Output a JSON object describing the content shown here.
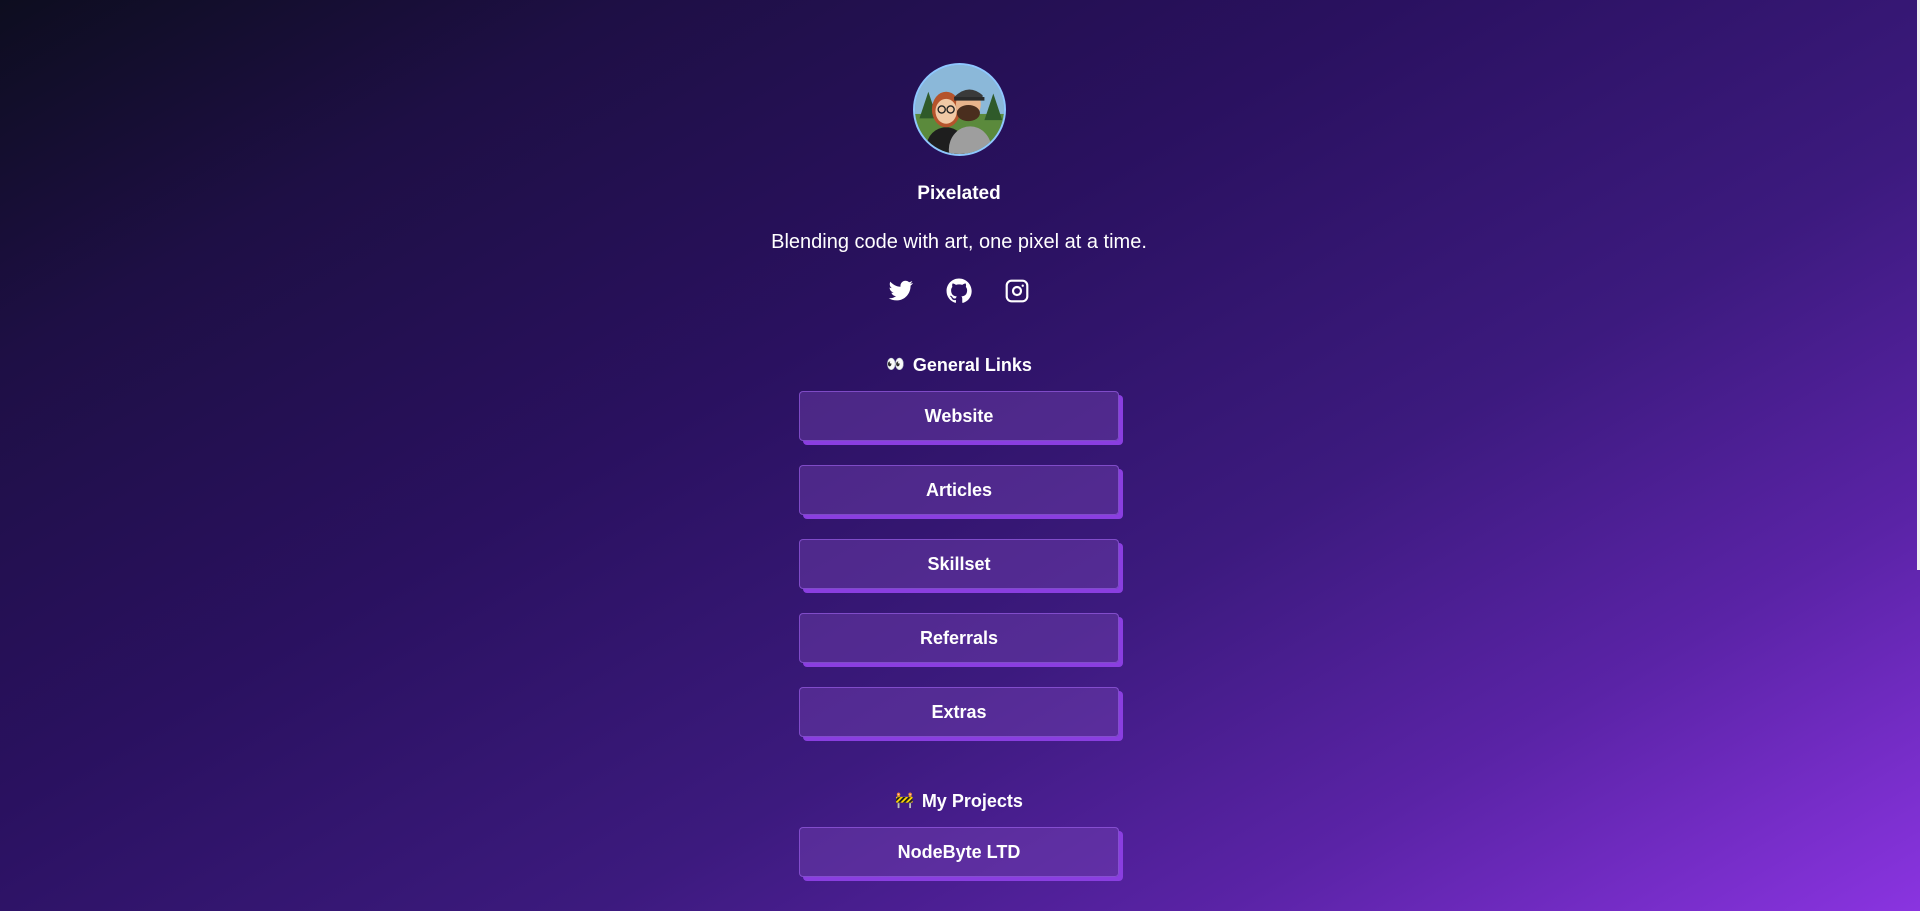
{
  "profile": {
    "name": "Pixelated",
    "bio": "Blending code with art, one pixel at a time."
  },
  "socials": [
    {
      "icon": "twitter-icon"
    },
    {
      "icon": "github-icon"
    },
    {
      "icon": "instagram-icon"
    }
  ],
  "sections": {
    "general": {
      "emoji": "👀",
      "title": "General Links",
      "links": [
        "Website",
        "Articles",
        "Skillset",
        "Referrals",
        "Extras"
      ]
    },
    "projects": {
      "emoji": "🚧",
      "title": "My Projects",
      "links": [
        "NodeByte LTD"
      ]
    }
  },
  "colors": {
    "accent": "#8a3ee0",
    "button_fill": "#4b2a7d",
    "avatar_ring": "#8fc7ff"
  }
}
